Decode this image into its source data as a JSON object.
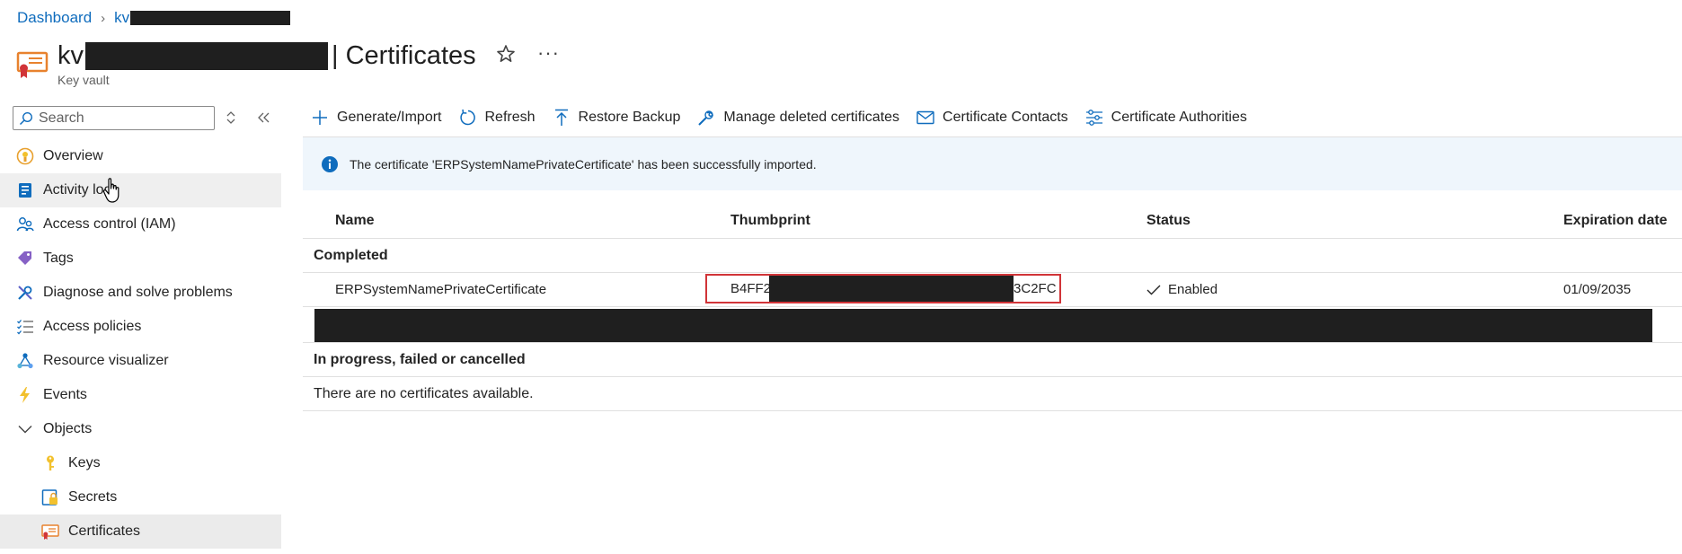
{
  "breadcrumb": {
    "dashboard": "Dashboard",
    "current_prefix": "kv"
  },
  "header": {
    "title_prefix": "kv",
    "title_suffix": "| Certificates",
    "subtitle": "Key vault",
    "icon": "certificate-icon",
    "favorite_icon": "star-icon",
    "more_icon": "more-icon",
    "more_label": "···"
  },
  "sidebar": {
    "search": {
      "placeholder": "Search",
      "value": ""
    },
    "items": [
      {
        "label": "Overview",
        "icon": "overview-icon"
      },
      {
        "label": "Activity log",
        "icon": "activity-log-icon"
      },
      {
        "label": "Access control (IAM)",
        "icon": "iam-icon"
      },
      {
        "label": "Tags",
        "icon": "tag-icon"
      },
      {
        "label": "Diagnose and solve problems",
        "icon": "wrench-icon"
      },
      {
        "label": "Access policies",
        "icon": "list-check-icon"
      },
      {
        "label": "Resource visualizer",
        "icon": "resource-visualizer-icon"
      },
      {
        "label": "Events",
        "icon": "lightning-icon"
      },
      {
        "label": "Objects",
        "icon": "chevron-down-icon"
      },
      {
        "label": "Keys",
        "icon": "key-icon"
      },
      {
        "label": "Secrets",
        "icon": "secret-icon"
      },
      {
        "label": "Certificates",
        "icon": "certificate-icon"
      }
    ]
  },
  "toolbar": {
    "generate_import": "Generate/Import",
    "refresh": "Refresh",
    "restore_backup": "Restore Backup",
    "manage_deleted": "Manage deleted certificates",
    "contacts": "Certificate Contacts",
    "authorities": "Certificate Authorities"
  },
  "notice": {
    "text": "The certificate 'ERPSystemNamePrivateCertificate' has been successfully imported."
  },
  "table": {
    "columns": {
      "name": "Name",
      "thumbprint": "Thumbprint",
      "status": "Status",
      "expiration": "Expiration date"
    },
    "groups": {
      "completed": "Completed",
      "in_progress": "In progress, failed or cancelled"
    },
    "rows": [
      {
        "name": "ERPSystemNamePrivateCertificate",
        "thumb_start": "B4FF2",
        "thumb_end": "3C2FC",
        "status": "Enabled",
        "expiration": "01/09/2035"
      }
    ],
    "empty_message": "There are no certificates available."
  },
  "colors": {
    "accent": "#0f6cbd",
    "highlight_border": "#d13438",
    "notice_bg": "#eff6fc",
    "cert_orange": "#e8822e"
  }
}
